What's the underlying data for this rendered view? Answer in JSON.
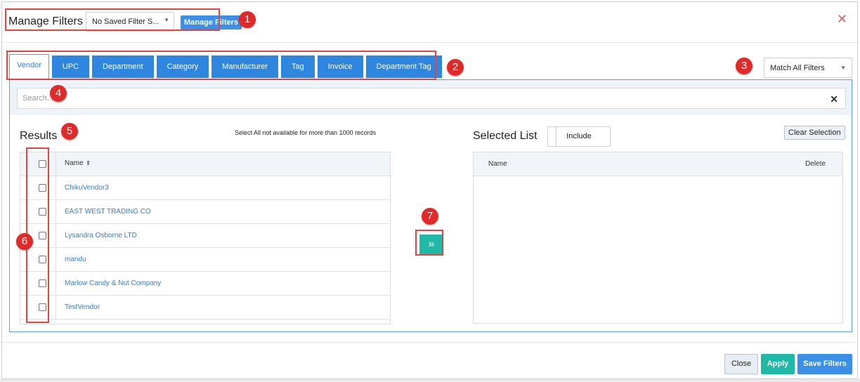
{
  "header": {
    "title": "Manage Filters",
    "saved_filter_value": "No Saved Filter S...",
    "manage_button": "Manage Filters",
    "close_symbol": "✕"
  },
  "tabs": [
    {
      "label": "Vendor",
      "active": true
    },
    {
      "label": "UPC"
    },
    {
      "label": "Department"
    },
    {
      "label": "Category"
    },
    {
      "label": "Manufacturer"
    },
    {
      "label": "Tag"
    },
    {
      "label": "Invoice"
    },
    {
      "label": "Department Tag"
    }
  ],
  "match_select": "Match All Filters",
  "search": {
    "placeholder": "Search...",
    "clear_symbol": "✕"
  },
  "results": {
    "title": "Results",
    "note": "Select All not available for more than 1000 records",
    "column_name": "Name",
    "rows": [
      "ChikuVendor3",
      "EAST WEST TRADING CO",
      "Lysandra Osborne LTD",
      "mandu",
      "Marlow Candy & Nut Company",
      "TestVendor"
    ]
  },
  "move_button": "»",
  "selected": {
    "title": "Selected List",
    "include_label": "Include",
    "clear_label": "Clear Selection",
    "column_name": "Name",
    "column_delete": "Delete"
  },
  "footer": {
    "close": "Close",
    "apply": "Apply",
    "save": "Save Filters"
  },
  "annotations": [
    "1",
    "2",
    "3",
    "4",
    "5",
    "6",
    "7"
  ],
  "colors": {
    "primary": "#3b8fe6",
    "teal": "#20b8a6",
    "highlight": "#e02a2a"
  }
}
